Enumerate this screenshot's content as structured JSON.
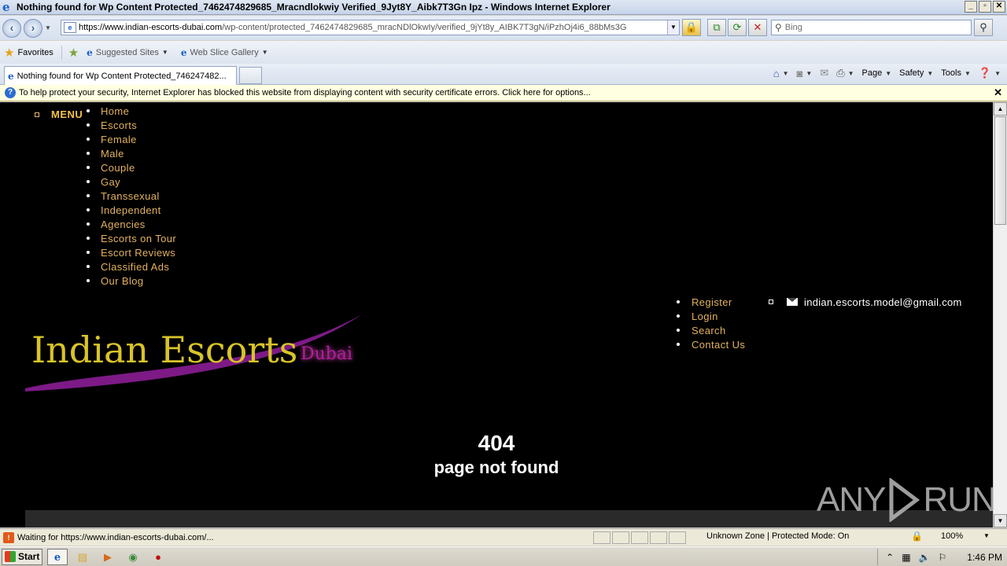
{
  "window": {
    "title": "Nothing found for Wp Content Protected_7462474829685_Mracndlokwiy Verified_9Jyt8Y_Aibk7T3Gn Ipz - Windows Internet Explorer",
    "buttons": [
      "_",
      "▫",
      "✕"
    ]
  },
  "addressbar": {
    "url_host": "https://www.indian-escorts-dubai.com",
    "url_path": "/wp-content/protected_7462474829685_mracNDlOkwIy/verified_9jYt8y_AIBK7T3gN/iPzhOj4i6_88bMs3G",
    "search_placeholder": "Bing"
  },
  "favorites": {
    "label": "Favorites",
    "items": [
      "Suggested Sites",
      "Web Slice Gallery"
    ]
  },
  "tab": {
    "label": "Nothing found for Wp Content Protected_746247482..."
  },
  "commandbar": {
    "page": "Page",
    "safety": "Safety",
    "tools": "Tools"
  },
  "infobar": {
    "text": "To help protect your security, Internet Explorer has blocked this website from displaying content with security certificate errors. Click here for options..."
  },
  "site": {
    "menu_label": "MENU",
    "nav": [
      "Home",
      "Escorts",
      "Female",
      "Male",
      "Couple",
      "Gay",
      "Transsexual",
      "Independent",
      "Agencies",
      "Escorts on Tour",
      "Escort Reviews",
      "Classified Ads",
      "Our Blog"
    ],
    "top_links": [
      "Register",
      "Login",
      "Search",
      "Contact Us"
    ],
    "email": "indian.escorts.model@gmail.com",
    "logo_main": "Indian Escorts",
    "logo_sub": "Dubai",
    "error_code": "404",
    "error_message": "page not found",
    "colors": {
      "link": "#e2b25e",
      "logo_gold": "#d8c428",
      "logo_purple": "#7d1a86"
    }
  },
  "watermark": {
    "left": "ANY",
    "right": "RUN"
  },
  "statusbar": {
    "text": "Waiting for https://www.indian-escorts-dubai.com/...",
    "zone": "Unknown Zone | Protected Mode: On",
    "zoom": "100%"
  },
  "taskbar": {
    "start": "Start",
    "time": "1:46 PM"
  }
}
